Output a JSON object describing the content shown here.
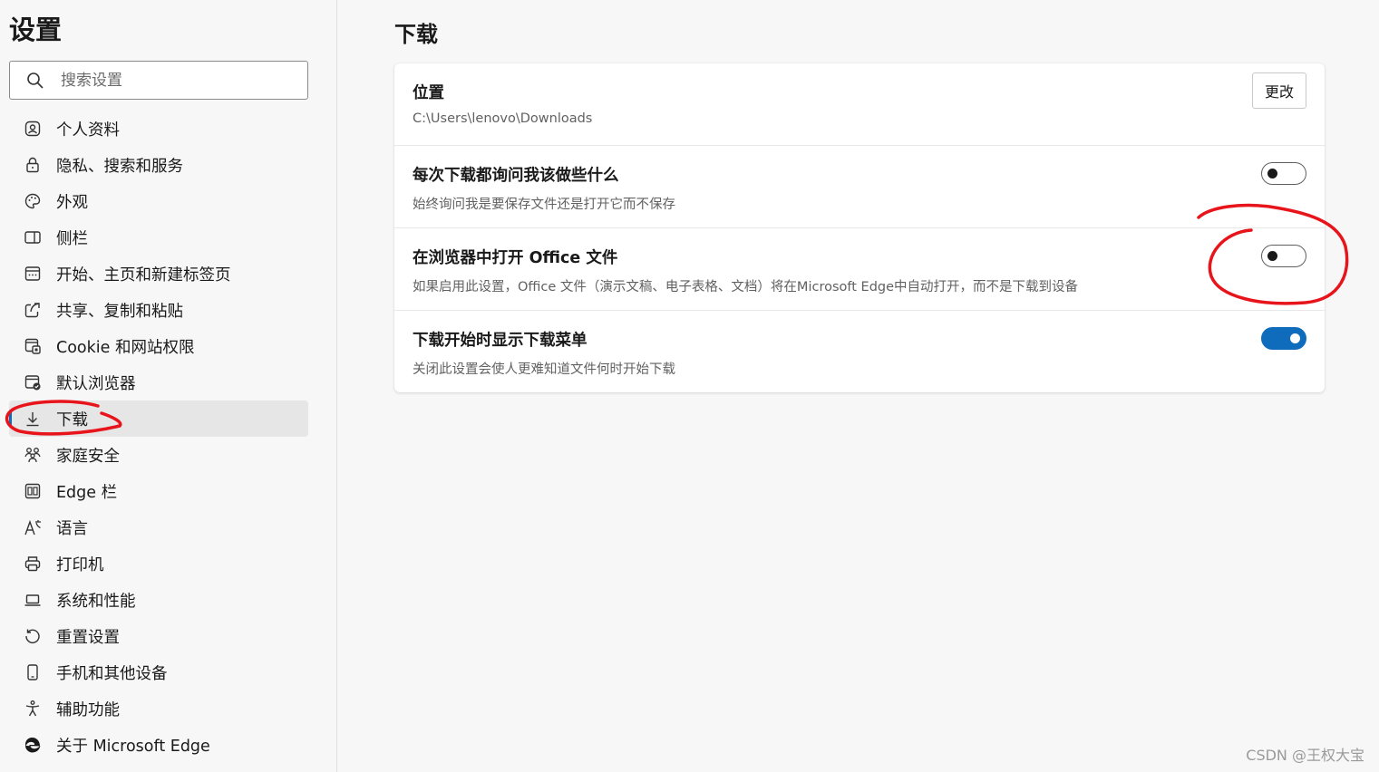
{
  "sidebar": {
    "title": "设置",
    "search_placeholder": "搜索设置",
    "items": [
      {
        "label": "个人资料",
        "icon": "profile-icon"
      },
      {
        "label": "隐私、搜索和服务",
        "icon": "lock-icon"
      },
      {
        "label": "外观",
        "icon": "palette-icon"
      },
      {
        "label": "侧栏",
        "icon": "sidebar-icon"
      },
      {
        "label": "开始、主页和新建标签页",
        "icon": "home-tabs-icon"
      },
      {
        "label": "共享、复制和粘贴",
        "icon": "share-icon"
      },
      {
        "label": "Cookie 和网站权限",
        "icon": "cookie-icon"
      },
      {
        "label": "默认浏览器",
        "icon": "default-browser-icon"
      },
      {
        "label": "下载",
        "icon": "download-icon",
        "active": true
      },
      {
        "label": "家庭安全",
        "icon": "family-icon"
      },
      {
        "label": "Edge 栏",
        "icon": "edge-bar-icon"
      },
      {
        "label": "语言",
        "icon": "language-icon"
      },
      {
        "label": "打印机",
        "icon": "printer-icon"
      },
      {
        "label": "系统和性能",
        "icon": "laptop-icon"
      },
      {
        "label": "重置设置",
        "icon": "reset-icon"
      },
      {
        "label": "手机和其他设备",
        "icon": "phone-icon"
      },
      {
        "label": "辅助功能",
        "icon": "accessibility-icon"
      },
      {
        "label": "关于 Microsoft Edge",
        "icon": "edge-logo-icon"
      }
    ]
  },
  "main": {
    "title": "下载",
    "location": {
      "title": "位置",
      "path": "C:\\Users\\lenovo\\Downloads",
      "change_button": "更改"
    },
    "ask_each_time": {
      "title": "每次下载都询问我该做些什么",
      "desc": "始终询问我是要保存文件还是打开它而不保存",
      "enabled": false
    },
    "open_office": {
      "title": "在浏览器中打开 Office 文件",
      "desc": "如果启用此设置，Office 文件（演示文稿、电子表格、文档）将在Microsoft Edge中自动打开，而不是下载到设备",
      "enabled": false
    },
    "show_menu": {
      "title": "下载开始时显示下载菜单",
      "desc": "关闭此设置会使人更难知道文件何时开始下载",
      "enabled": true
    }
  },
  "colors": {
    "accent": "#0f6cbd",
    "annotation": "#e8141b"
  },
  "watermark": "CSDN @王权大宝"
}
